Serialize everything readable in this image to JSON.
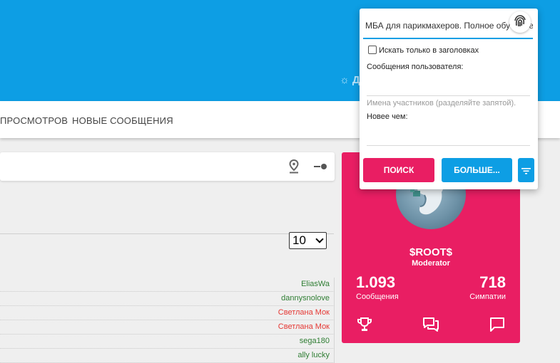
{
  "header": {
    "style_link": "☼ Д"
  },
  "nav": {
    "items": [
      "ПРОСМОТРОВ",
      "НОВЫЕ СООБЩЕНИЯ"
    ]
  },
  "filter": {
    "pin_icon": "map-pin-icon",
    "toggle_icon": "toggle-icon"
  },
  "list": {
    "page_size": "10",
    "users": [
      {
        "name": "EliasWa",
        "color": "#2e7d32"
      },
      {
        "name": "dannysnolove",
        "color": "#2e7d32"
      },
      {
        "name": "Светлана Мок",
        "color": "#e53935"
      },
      {
        "name": "Светлана Мок",
        "color": "#e53935"
      },
      {
        "name": "sega180",
        "color": "#2e7d32"
      },
      {
        "name": "ally lucky",
        "color": "#2e7d32"
      }
    ]
  },
  "profile": {
    "name": "$ROOT$",
    "role": "Moderator",
    "messages_value": "1.093",
    "messages_label": "Сообщения",
    "likes_value": "718",
    "likes_label": "Симпатии",
    "icons": [
      "trophy-icon",
      "conversations-icon",
      "comment-icon"
    ],
    "accent": "#e91e63"
  },
  "search": {
    "query": "МБА для парикмахеров. Полное обучение",
    "titles_only_label": "Искать только в заголовках",
    "user_messages_label": "Сообщения пользователя:",
    "members_placeholder": "Имена участников (разделяйте запятой).",
    "newer_than_label": "Новее чем:",
    "search_button": "ПОИСК",
    "more_button": "БОЛЬШЕ...",
    "filter_icon": "filter-icon",
    "fingerprint_icon": "fingerprint-icon",
    "accent": "#0d9ee4"
  }
}
